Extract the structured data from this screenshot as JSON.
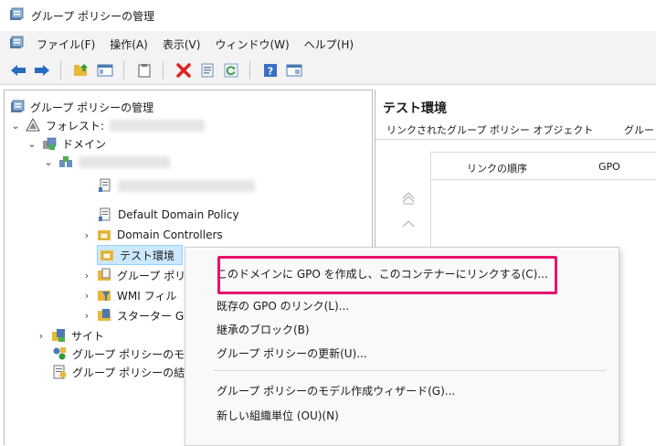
{
  "window": {
    "title": "グループ ポリシーの管理"
  },
  "menubar": {
    "items": [
      "ファイル(F)",
      "操作(A)",
      "表示(V)",
      "ウィンドウ(W)",
      "ヘルプ(H)"
    ]
  },
  "toolbar": {
    "buttons": [
      "back-icon",
      "forward-icon",
      "up-folder-icon",
      "show-hide-tree-icon",
      "clipboard-icon",
      "delete-icon",
      "properties-icon",
      "refresh-icon",
      "help-icon",
      "console-icon"
    ]
  },
  "tree": {
    "root": "グループ ポリシーの管理",
    "forest_prefix": "フォレスト:",
    "domains": "ドメイン",
    "items": {
      "default_domain_policy": "Default Domain Policy",
      "domain_controllers": "Domain Controllers",
      "test_env": "テスト環境",
      "gp_objects": "グループ ポリ",
      "wmi_filters": "WMI フィル",
      "starter_gpo": "スターター G",
      "sites": "サイト",
      "gp_modeling": "グループ ポリシーのモ",
      "gp_results": "グループ ポリシーの結"
    }
  },
  "right_pane": {
    "heading": "テスト環境",
    "tabs": [
      "リンクされたグループ ポリシー オブジェクト",
      "グルー"
    ],
    "columns": {
      "link_order": "リンクの順序",
      "gpo": "GPO"
    }
  },
  "context_menu": {
    "items": [
      "このドメインに GPO を作成し、このコンテナーにリンクする(C)...",
      "既存の GPO のリンク(L)...",
      "継承のブロック(B)",
      "グループ ポリシーの更新(U)...",
      "グループ ポリシーのモデル作成ウィザード(G)...",
      "新しい組織単位 (OU)(N)"
    ],
    "highlight_color": "#e8136d"
  }
}
